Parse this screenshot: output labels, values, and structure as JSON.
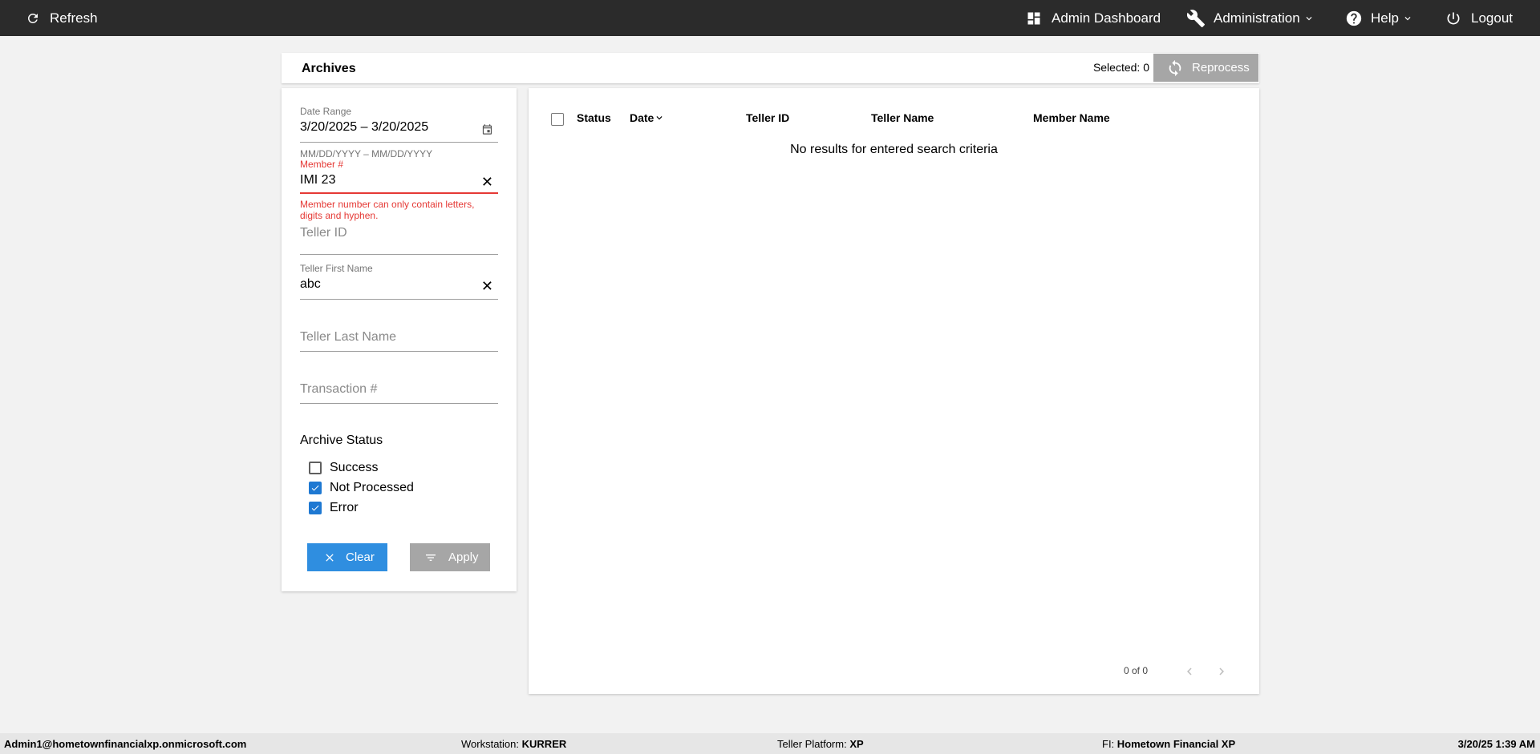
{
  "topbar": {
    "refresh_label": "Refresh",
    "admin_dashboard_label": "Admin Dashboard",
    "administration_label": "Administration",
    "help_label": "Help",
    "logout_label": "Logout"
  },
  "page": {
    "title": "Archives",
    "selected_label": "Selected:",
    "selected_count": "0",
    "reprocess_label": "Reprocess"
  },
  "filters": {
    "date_range": {
      "label": "Date Range",
      "value": "3/20/2025 – 3/20/2025",
      "hint": "MM/DD/YYYY – MM/DD/YYYY"
    },
    "member": {
      "label": "Member #",
      "value": "IMI 23",
      "error": "Member number can only contain letters, digits and hyphen."
    },
    "teller_id": {
      "placeholder": "Teller ID"
    },
    "teller_first_name": {
      "label": "Teller First Name",
      "value": "abc"
    },
    "teller_last_name": {
      "placeholder": "Teller Last Name"
    },
    "transaction": {
      "placeholder": "Transaction #"
    },
    "archive_status": {
      "title": "Archive Status",
      "options": [
        {
          "label": "Success",
          "checked": false
        },
        {
          "label": "Not Processed",
          "checked": true
        },
        {
          "label": "Error",
          "checked": true
        }
      ]
    },
    "clear_label": "Clear",
    "apply_label": "Apply"
  },
  "results": {
    "columns": [
      "Status",
      "Date",
      "Teller ID",
      "Teller Name",
      "Member Name"
    ],
    "empty_message": "No results for entered search criteria",
    "pager_text": "0 of 0"
  },
  "statusbar": {
    "user": "Admin1@hometownfinancialxp.onmicrosoft.com",
    "workstation_label": "Workstation:",
    "workstation_value": "KURRER",
    "platform_label": "Teller Platform:",
    "platform_value": "XP",
    "fi_label": "FI:",
    "fi_value": "Hometown Financial XP",
    "datetime": "3/20/25 1:39 AM"
  },
  "colors": {
    "topbar_bg": "#2b2b2b",
    "accent_blue": "#2f8ee0",
    "error_red": "#e53935",
    "disabled_gray": "#a6a6a6"
  }
}
